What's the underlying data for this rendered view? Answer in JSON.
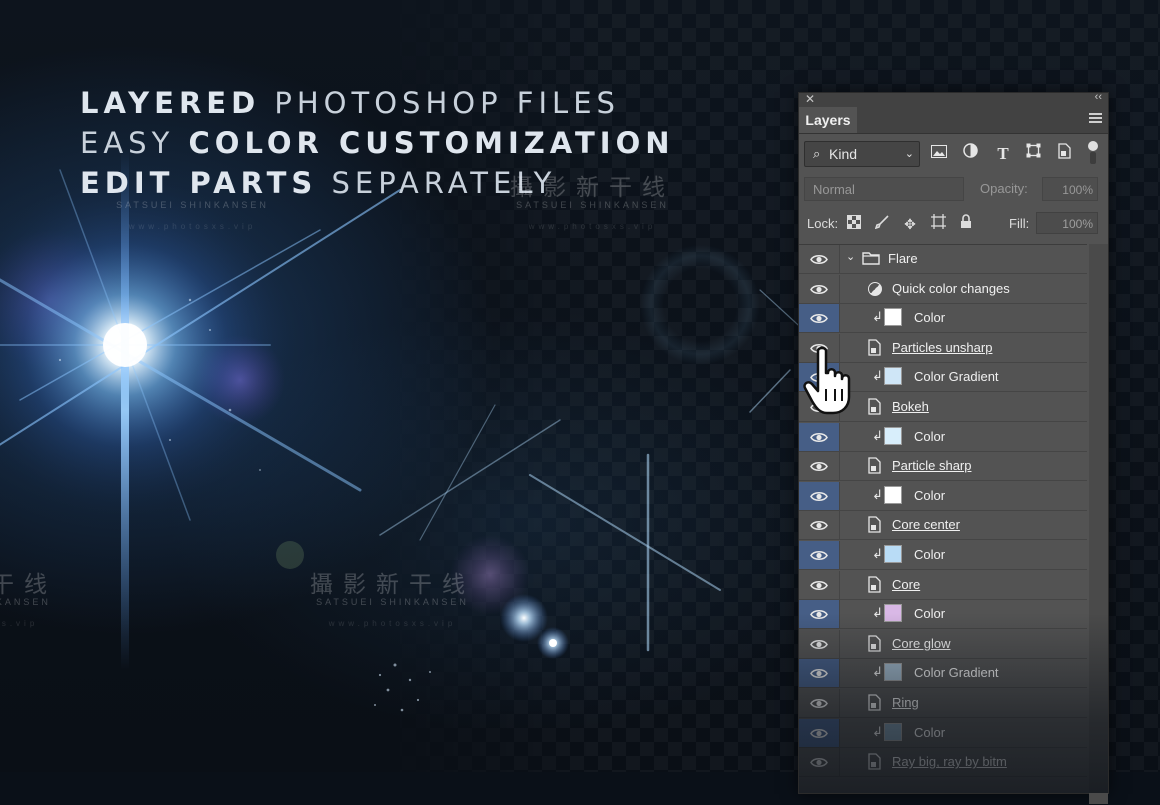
{
  "headline": {
    "line1": {
      "bold": "LAYERED",
      "light": " PHOTOSHOP FILES"
    },
    "line2": {
      "light": "EASY ",
      "bold": "COLOR CUSTOMIZATION"
    },
    "line3": {
      "bold": "EDIT PARTS",
      "light": " SEPARATELY"
    }
  },
  "watermark": {
    "chinese": "攝影新干线",
    "english": "SATSUEI SHINKANSEN",
    "url": "www.photosxs.vip"
  },
  "panel": {
    "close_glyph": "✕",
    "collapse_glyph": "‹‹",
    "tab_label": "Layers",
    "filter": {
      "kind_label": "Kind",
      "search_icon": "search-icon"
    },
    "blend_mode": "Normal",
    "opacity_label": "Opacity:",
    "opacity_value": "100%",
    "lock_label": "Lock:",
    "fill_label": "Fill:",
    "fill_value": "100%",
    "layers": [
      {
        "name": "Flare",
        "type": "group",
        "indent": 0,
        "highlight": false,
        "underline": false
      },
      {
        "name": "Quick color changes",
        "type": "adjustment",
        "indent": 1,
        "highlight": false,
        "underline": false
      },
      {
        "name": "Color",
        "type": "fill",
        "indent": 2,
        "swatch": "#ffffff",
        "highlight": true,
        "underline": false
      },
      {
        "name": "Particles unsharp",
        "type": "smart",
        "indent": 1,
        "highlight": false,
        "underline": true
      },
      {
        "name": "Color Gradient",
        "type": "fill",
        "indent": 2,
        "swatch": "#cfe6f7",
        "highlight": true,
        "underline": false
      },
      {
        "name": "Bokeh",
        "type": "smart",
        "indent": 1,
        "highlight": false,
        "underline": true
      },
      {
        "name": "Color",
        "type": "fill",
        "indent": 2,
        "swatch": "#d8eefb",
        "highlight": true,
        "underline": false
      },
      {
        "name": "Particle sharp",
        "type": "smart",
        "indent": 1,
        "highlight": false,
        "underline": true
      },
      {
        "name": "Color",
        "type": "fill",
        "indent": 2,
        "swatch": "#ffffff",
        "highlight": true,
        "underline": false
      },
      {
        "name": "Core center",
        "type": "smart",
        "indent": 1,
        "highlight": false,
        "underline": true
      },
      {
        "name": "Color",
        "type": "fill",
        "indent": 2,
        "swatch": "#b9dcf6",
        "highlight": true,
        "underline": false
      },
      {
        "name": "Core",
        "type": "smart",
        "indent": 1,
        "highlight": false,
        "underline": true
      },
      {
        "name": "Color",
        "type": "fill",
        "indent": 2,
        "swatch": "#d9b8e6",
        "highlight": true,
        "underline": false
      },
      {
        "name": "Core glow",
        "type": "smart",
        "indent": 1,
        "highlight": false,
        "underline": true
      },
      {
        "name": "Color Gradient",
        "type": "fill",
        "indent": 2,
        "swatch": "#9fb6c8",
        "highlight": true,
        "underline": false
      },
      {
        "name": "Ring",
        "type": "smart",
        "indent": 1,
        "highlight": false,
        "underline": true
      },
      {
        "name": "Color",
        "type": "fill",
        "indent": 2,
        "swatch": "#7d97aa",
        "highlight": true,
        "underline": false
      },
      {
        "name": "Ray big, ray by bitm",
        "type": "smart",
        "indent": 1,
        "highlight": false,
        "underline": true
      }
    ]
  },
  "colors": {
    "panel_bg": "#535353",
    "eye_highlight": "#465e86",
    "headline": "#dfe6ee"
  }
}
